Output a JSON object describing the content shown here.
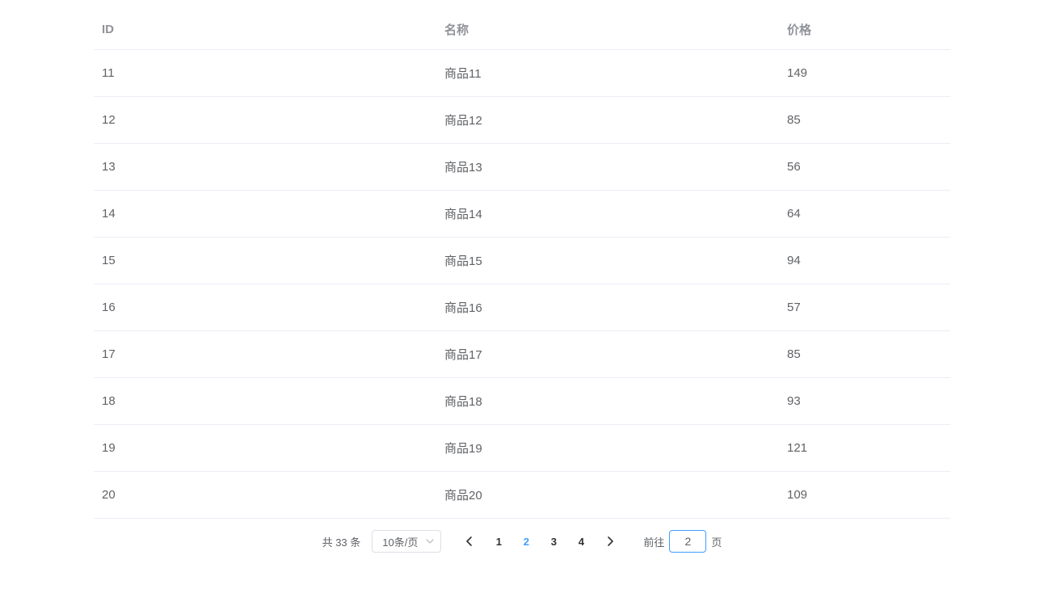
{
  "table": {
    "headers": {
      "id": "ID",
      "name": "名称",
      "price": "价格"
    },
    "rows": [
      {
        "id": "11",
        "name": "商品11",
        "price": "149"
      },
      {
        "id": "12",
        "name": "商品12",
        "price": "85"
      },
      {
        "id": "13",
        "name": "商品13",
        "price": "56"
      },
      {
        "id": "14",
        "name": "商品14",
        "price": "64"
      },
      {
        "id": "15",
        "name": "商品15",
        "price": "94"
      },
      {
        "id": "16",
        "name": "商品16",
        "price": "57"
      },
      {
        "id": "17",
        "name": "商品17",
        "price": "85"
      },
      {
        "id": "18",
        "name": "商品18",
        "price": "93"
      },
      {
        "id": "19",
        "name": "商品19",
        "price": "121"
      },
      {
        "id": "20",
        "name": "商品20",
        "price": "109"
      }
    ]
  },
  "pagination": {
    "total_prefix": "共 ",
    "total_count": "33",
    "total_suffix": " 条",
    "page_size_label": "10条/页",
    "pages": [
      "1",
      "2",
      "3",
      "4"
    ],
    "current_page": "2",
    "jump_prefix": "前往",
    "jump_value": "2",
    "jump_suffix": "页"
  }
}
